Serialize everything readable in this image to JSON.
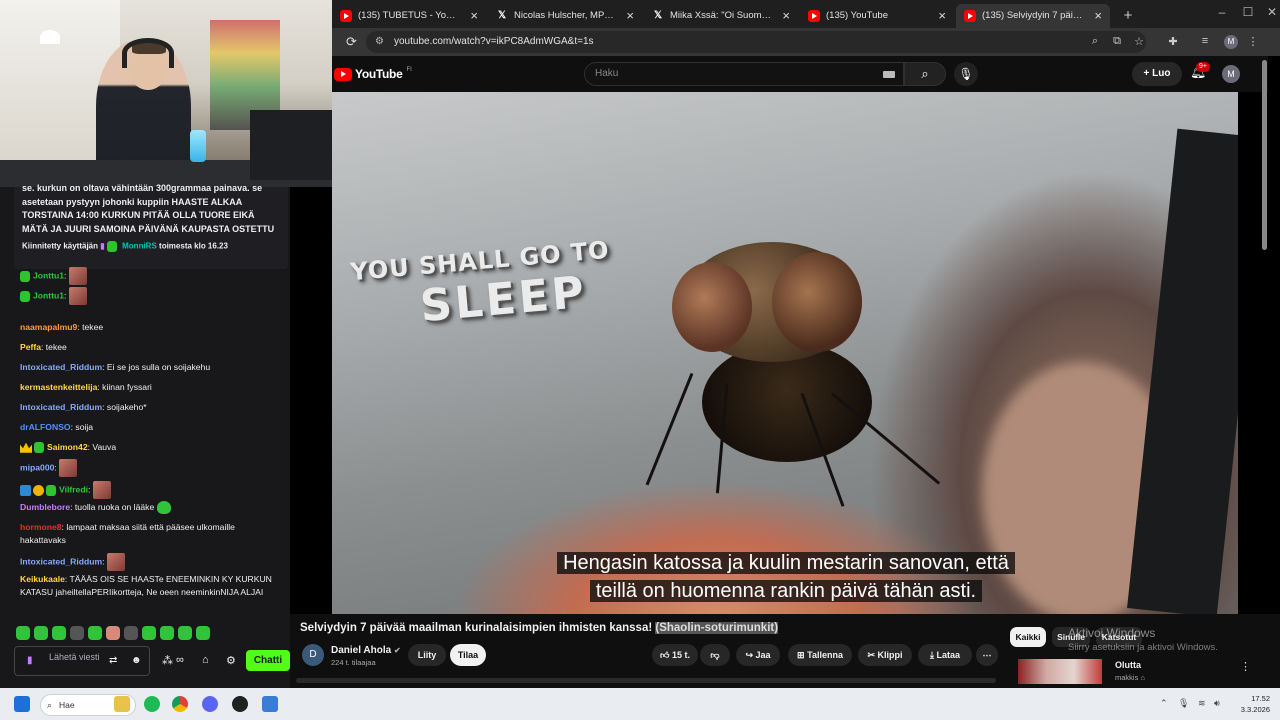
{
  "browser": {
    "tabs": [
      {
        "title": "(135) TUBETUS - YouTube",
        "icon": "youtube-icon"
      },
      {
        "title": "Nicolas Hulscher, MPH Xssä: \"I",
        "icon": "x-icon"
      },
      {
        "title": "Miika Xssä: \"Oi Suomi on! rur",
        "icon": "x-icon"
      },
      {
        "title": "(135) YouTube",
        "icon": "youtube-icon"
      },
      {
        "title": "(135) Selviydyin 7 päivää m",
        "icon": "youtube-icon",
        "active": true
      }
    ],
    "url": "youtube.com/watch?v=ikPC8AdmWGA&t=1s",
    "profile_initial": "M"
  },
  "youtube": {
    "logo": "YouTube",
    "region": "FI",
    "search_placeholder": "Haku",
    "create_label": "Luo",
    "notification_count": "9+",
    "avatar_initial": "M",
    "video": {
      "thumbnail_text_line1": "YOU SHALL GO TO",
      "thumbnail_text_line2": "SLEEP",
      "caption_line1": "Hengasin katossa ja kuulin mestarin sanovan, että",
      "caption_line2": "teillä on huomenna rankin päivä tähän asti.",
      "title_main": "Selviydyin 7 päivää maailman kurinalaisimpien ihmisten kanssa! ",
      "title_highlight": "(Shaolin-soturimunkit)",
      "channel": "Daniel Ahola",
      "channel_initial": "D",
      "subscribers": "224 t. tilaajaa",
      "join_label": "Liity",
      "subscribe_label": "Tilaa",
      "likes": "15 t.",
      "share_label": "Jaa",
      "save_label": "Tallenna",
      "clip_label": "Klippi",
      "download_label": "Lataa"
    },
    "filters": [
      "Kaikki",
      "Sinulle",
      "Katsotut"
    ],
    "recommendation": {
      "title": "Olutta",
      "channel": "makkis ⌂"
    }
  },
  "windows_watermark": {
    "line1": "Aktivoi Windows",
    "line2": "Siirry asetuksiin ja aktivoi Windows."
  },
  "chat": {
    "pinned": {
      "text": "se. kurkun on oltava vähintään 300grammaa painava. se asetetaan pystyyn johonki kuppiin HAASTE ALKAA TORSTAINA 14:00 KURKUN PITÄÄ OLLA TUORE EIKÄ MÄTÄ JA JUURI SAMOINA PÄIVÄNÄ KAUPASTA OSTETTU",
      "pinned_by_label": "Kiinnitetty käyttäjän",
      "pinned_by_user": "MonniRS",
      "pinned_time": "toimesta klo 16.23"
    },
    "messages": [
      {
        "user": "Jonttu1",
        "text": "",
        "color": "#31c43b"
      },
      {
        "user": "Jonttu1",
        "text": "",
        "color": "#31c43b"
      },
      {
        "user": "naamapalmu9",
        "text": "tekee",
        "color": "#ff9a3c"
      },
      {
        "user": "Peffa",
        "text": "tekee",
        "color": "#ffd84a"
      },
      {
        "user": "Intoxicated_Riddum",
        "text": "Ei se jos sulla on soijakehu",
        "color": "#8aa8ff"
      },
      {
        "user": "kermastenkeittelija",
        "text": "kiinan fyssari",
        "color": "#ffd84a"
      },
      {
        "user": "Intoxicated_Riddum",
        "text": "soijakeho*",
        "color": "#8aa8ff"
      },
      {
        "user": "drALFONSO",
        "text": "soija",
        "color": "#5b8cff"
      },
      {
        "user": "Saimon42",
        "text": "Vauva",
        "color": "#ffd84a"
      },
      {
        "user": "mipa000",
        "text": "",
        "color": "#8aa8ff"
      },
      {
        "user": "Vilfredi",
        "text": "",
        "color": "#31c43b"
      },
      {
        "user": "Dumblebore",
        "text": "tuolla ruoka on lääke",
        "color": "#c77dff"
      },
      {
        "user": "hormone8",
        "text": "lampaat maksaa siitä että pääsee ulkomaille hakattavaks",
        "color": "#e0322f"
      },
      {
        "user": "Intoxicated_Riddum",
        "text": "",
        "color": "#8aa8ff"
      },
      {
        "user": "Keikukaale",
        "text": "TÄÄÄS OIS SE HAASTe ENEEMINKIN KY KURKUN KATASU jaheiltellaPERIikortteja, Ne oeen neeminkinNIJA ALJAI",
        "color": "#ffd84a"
      }
    ],
    "input_placeholder": "Lähetä viesti",
    "send_label": "Chatti"
  },
  "taskbar": {
    "search_label": "Hae",
    "time": "17.52",
    "date": "3.3.2026"
  }
}
